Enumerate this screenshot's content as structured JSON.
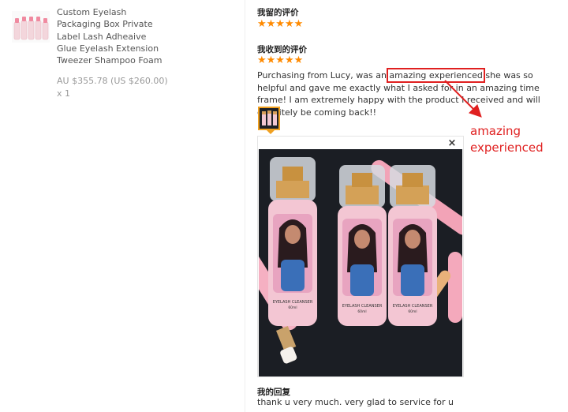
{
  "product": {
    "title": "Custom Eyelash Packaging Box Private Label Lash Adheaive Glue Eyelash Extension Tweezer Shampoo Foam",
    "price": "AU $355.78 (US $260.00) x 1",
    "thumb_icon": "product-bottles-image"
  },
  "my_review": {
    "heading": "我留的评价",
    "rating": 5,
    "stars_text": "★★★★★"
  },
  "received_review": {
    "heading": "我收到的评价",
    "rating": 5,
    "stars_text": "★★★★★",
    "text_before": "Purchasing from Lucy, was an ",
    "text_highlight": "amazing experienced",
    "text_after": " she was so helpful and gave me exactly what I asked for in an amazing time frame! I am extremely happy with the product I received and will definitely be coming back!!",
    "photo_close": "×",
    "bottle_label": "EYELASH CLEANSER",
    "bottle_volume": "60ml"
  },
  "annotation": {
    "label": "amazing experienced",
    "color": "#e02020"
  },
  "reply": {
    "heading": "我的回复",
    "text": "thank u very much. very glad to service for u"
  },
  "colors": {
    "star": "#ff8a00",
    "thumb_border": "#f0a020",
    "annotation": "#e02020"
  }
}
